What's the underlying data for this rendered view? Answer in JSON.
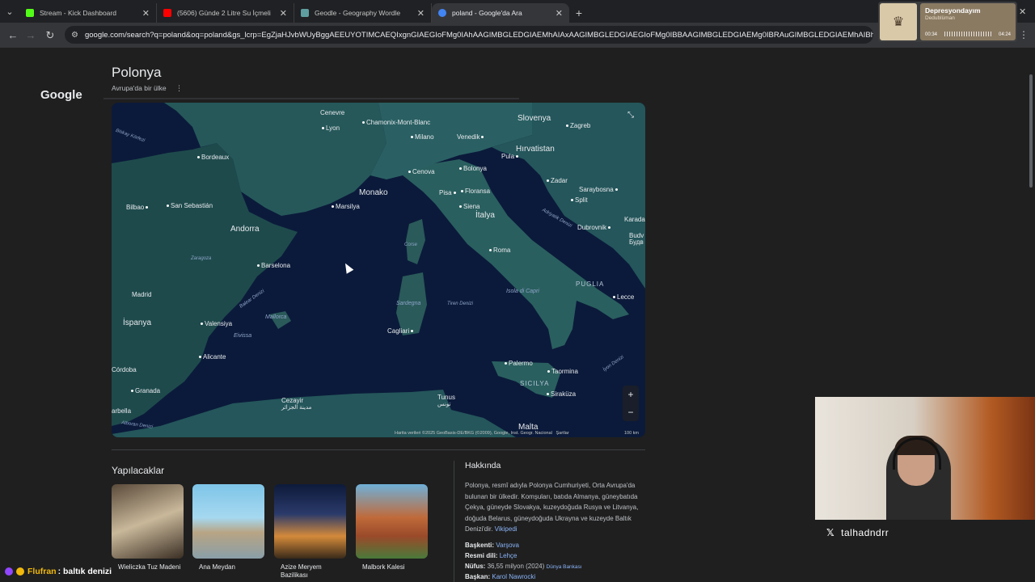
{
  "browser": {
    "tabs": [
      {
        "title": "Stream - Kick Dashboard",
        "color": "#53fc18"
      },
      {
        "title": "(5606) Günde 2 Litre Su İçmeli",
        "color": "#ff0000"
      },
      {
        "title": "Geodle - Geography Wordle",
        "color": "#5f9ea0"
      },
      {
        "title": "poland - Google'da Ara",
        "color": "#4285f4"
      }
    ],
    "url": "google.com/search?q=poland&oq=poland&gs_lcrp=EgZjaHJvbWUyBggAEEUYOTIMCAEQIxgnGIAEGIoFMg0IAhAAGIMBGLEDGIAEMhAIAxAAGIMBGLEDGIAEGIoFMg0IBBAAGIMBGLEDGIAEMg0IBRAuGIMBGLEDGIAEMhAIBhAAGIMBGLE..."
  },
  "media": {
    "song": "Depresyondayım",
    "artist": "Dedublüman",
    "elapsed": "00:34",
    "total": "04:24"
  },
  "search": {
    "logo": "Google"
  },
  "entity": {
    "title": "Polonya",
    "subtitle": "Avrupa'da bir ülke"
  },
  "map": {
    "labels": {
      "cenevre": "Cenevre",
      "lyon": "Lyon",
      "chamonix": "Chamonix-Mont-Blanc",
      "milano": "Milano",
      "venedik": "Venedik",
      "slovenya": "Slovenya",
      "zagreb": "Zagreb",
      "hirvatistan": "Hırvatistan",
      "pula": "Pula",
      "bordeaux": "Bordeaux",
      "cenova": "Cenova",
      "bolonya": "Bolonya",
      "zadar": "Zadar",
      "saraybosna": "Saraybosna",
      "monako": "Monako",
      "pisa": "Pisa",
      "floransa": "Floransa",
      "split": "Split",
      "bilbao": "Bilbao",
      "sansebastian": "San Sebastián",
      "marsilya": "Marsilya",
      "siena": "Siena",
      "italya": "İtalya",
      "dubrovnik": "Dubrovnik",
      "andorra": "Andorra",
      "zaragoza": "Zaragoza",
      "barselona": "Barselona",
      "corse": "Corse",
      "roma": "Roma",
      "madrid": "Madrid",
      "isoladicapri": "Isola di Capri",
      "puglia": "PUGLIA",
      "lecce": "Lecce",
      "ispanya": "İspanya",
      "valensiya": "Valensiya",
      "mallorca": "Mallorca",
      "sardegna": "Sardegna",
      "tirendenizi": "Tiren Denizi",
      "eivissa": "Eivissa",
      "cagliari": "Cagliari",
      "alicante": "Alicante",
      "palermo": "Palermo",
      "taormina": "Taormina",
      "sicilya": "SICILYA",
      "kordoba": "Córdoba",
      "granada": "Granada",
      "sirakuza": "Siraküza",
      "cezayir": "Cezayir",
      "cezayir_ar": "مدينة الجزائر",
      "tunus": "Tunus",
      "tunus_ar": "تونس",
      "malta": "Malta",
      "marbella": "arbella",
      "biskay": "Biskay Körfezi",
      "balear": "Balear Denizi",
      "adriyatik": "Adriyatik Denizi",
      "iyon": "İyon Denizi",
      "alboran": "Alboran Denizi",
      "karada": "Karada",
      "budv": "Budv",
      "budva": "Будв"
    },
    "attribution": "Harita verileri ©2025 GeoBasis-DE/BKG (©2009), Google, Inst. Geogr. Nacional",
    "terms": "Şartlar",
    "scale": "100 km"
  },
  "things_to_do": {
    "title": "Yapılacaklar",
    "items": [
      {
        "caption": "Wieliczka Tuz Madeni"
      },
      {
        "caption": "Ana Meydan"
      },
      {
        "caption": "Azize Meryem Bazilikası"
      },
      {
        "caption": "Malbork Kalesi"
      }
    ]
  },
  "about": {
    "title": "Hakkında",
    "text": "Polonya, resmî adıyla Polonya Cumhuriyeti, Orta Avrupa'da bulunan bir ülkedir. Komşuları, batıda Almanya, güneybatıda Çekya, güneyde Slovakya, kuzeydoğuda Rusya ve Litvanya, doğuda Belarus, güneydoğuda Ukrayna ve kuzeyde Baltık Denizi'dir.",
    "wiki": "Vikipedi",
    "facts": [
      {
        "label": "Başkenti:",
        "value": "Varşova",
        "link": true
      },
      {
        "label": "Resmi dili:",
        "value": "Lehçe",
        "link": true
      },
      {
        "label": "Nüfus:",
        "value": "36,55 milyon (2024)",
        "source": "Dünya Bankası"
      },
      {
        "label": "Başkan:",
        "value": "Karol Nawrocki",
        "link": true
      }
    ]
  },
  "stream": {
    "handle": "talhadndrr",
    "chat_user": "Flufran",
    "chat_msg": ": baltık denizi"
  }
}
